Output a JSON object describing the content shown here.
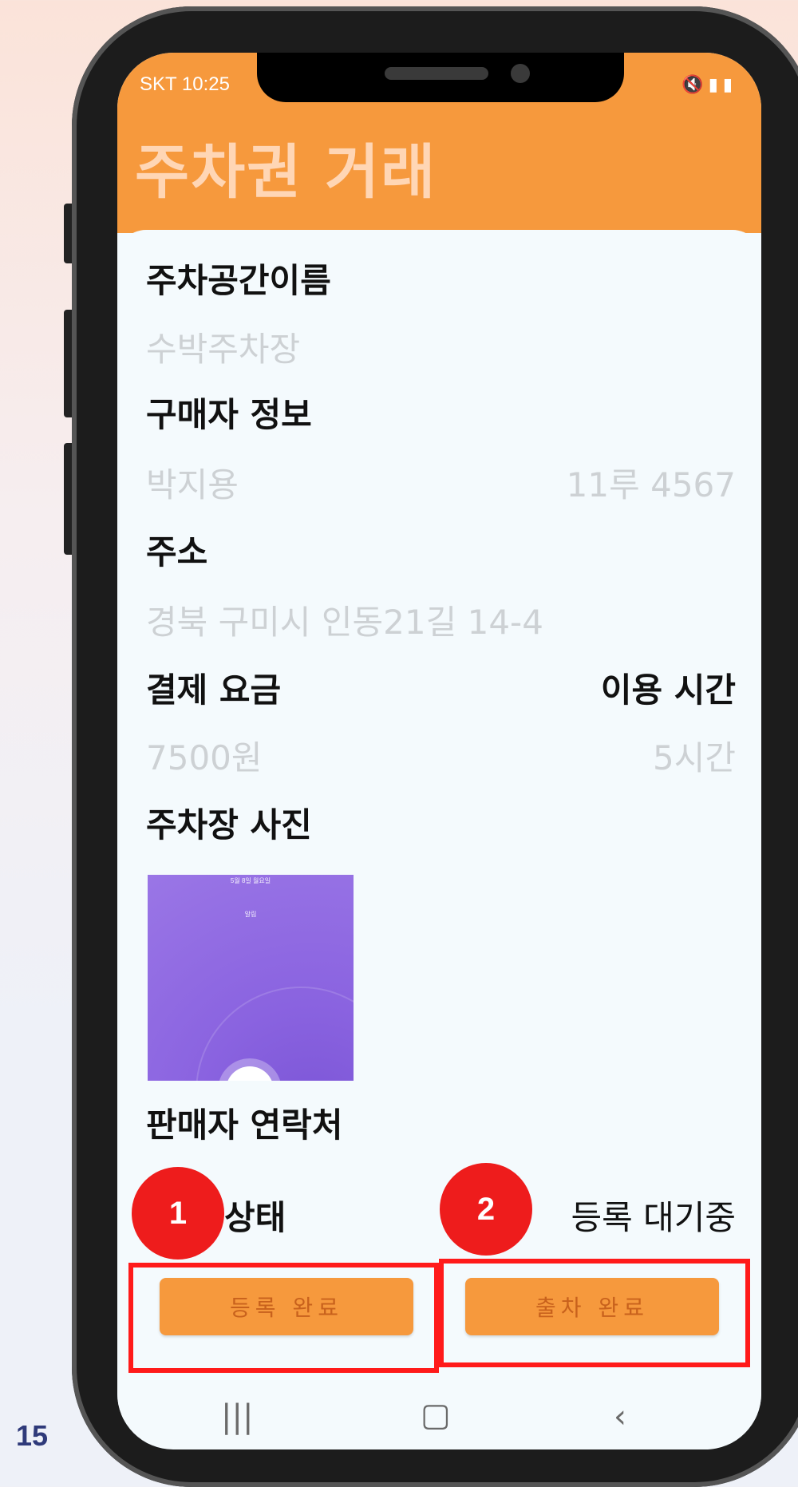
{
  "page_number": "15",
  "status_bar": {
    "carrier_time": "SKT 10:25",
    "icons": [
      "mute-icon",
      "5g-icon",
      "signal-icon",
      "battery-icon"
    ]
  },
  "header": {
    "title": "주차권 거래"
  },
  "details": {
    "space_name_label": "주차공간이름",
    "space_name_value": "수박주차장",
    "buyer_label": "구매자 정보",
    "buyer_name": "박지용",
    "buyer_plate": "11루 4567",
    "address_label": "주소",
    "address_value": "경북 구미시 인동21길 14-4",
    "fee_label": "결제 요금",
    "fee_value": "7500원",
    "duration_label": "이용 시간",
    "duration_value": "5시간",
    "photo_label": "주차장 사진",
    "photo_text_top": "5월 8일 월요일",
    "photo_text_mid": "알림",
    "seller_contact_label": "판매자 연락처",
    "status_label": "상태",
    "status_value": "등록 대기중"
  },
  "buttons": {
    "register_done": "등록 완료",
    "exit_done": "출차 완료"
  },
  "annotations": {
    "badge_1": "1",
    "badge_2": "2",
    "highlight_color": "#ff1a1a"
  },
  "colors": {
    "accent": "#f6993d",
    "title_text": "#ffd6b5",
    "muted_value": "#cdd1d4"
  }
}
